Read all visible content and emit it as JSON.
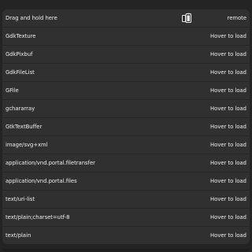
{
  "drag_row": {
    "label": "Drag and hold here",
    "icon": "clipboard-paste-icon",
    "value": "remote"
  },
  "rows": [
    {
      "name": "GdkTexture",
      "value": "Hover to load"
    },
    {
      "name": "GdkPixbuf",
      "value": "Hover to load"
    },
    {
      "name": "GdkFileList",
      "value": "Hover to load"
    },
    {
      "name": "GFile",
      "value": "Hover to load"
    },
    {
      "name": "gchararray",
      "value": "Hover to load"
    },
    {
      "name": "GtkTextBuffer",
      "value": "Hover to load"
    },
    {
      "name": "image/svg+xml",
      "value": "Hover to load"
    },
    {
      "name": "application/vnd.portal.filetransfer",
      "value": "Hover to load"
    },
    {
      "name": "application/vnd.portal.files",
      "value": "Hover to load"
    },
    {
      "name": "text/uri-list",
      "value": "Hover to load"
    },
    {
      "name": "text/plain;charset=utf-8",
      "value": "Hover to load"
    },
    {
      "name": "text/plain",
      "value": "Hover to load"
    }
  ],
  "colors": {
    "background": "#242424",
    "list_background": "#303030",
    "text": "#f0f0f0"
  }
}
